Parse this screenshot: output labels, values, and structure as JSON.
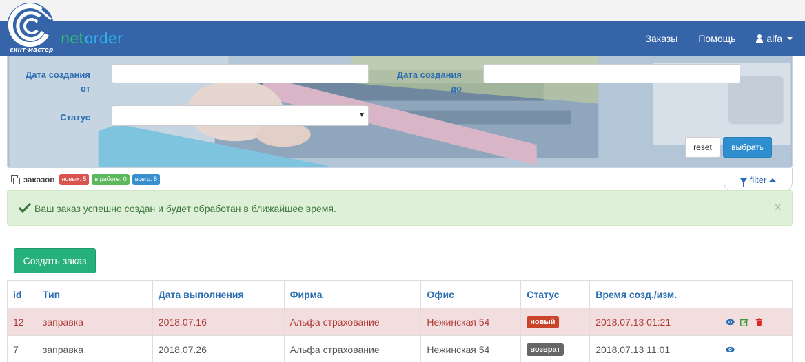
{
  "brand": {
    "logo_text": "синт-мастер",
    "name_part1": "net",
    "name_part2": "order"
  },
  "nav": {
    "orders": "Заказы",
    "help": "Помощь",
    "user": "alfa"
  },
  "filter": {
    "date_from_label_line1": "Дата создания",
    "date_from_label_line2": "от",
    "date_to_label_line1": "Дата создания",
    "date_to_label_line2": "до",
    "status_label": "Статус",
    "date_from_value": "",
    "date_to_value": "",
    "status_value": "",
    "reset_label": "reset",
    "select_label": "выбрать",
    "toggle_label": "filter"
  },
  "stats": {
    "label": "заказов",
    "new_badge": "новых: 5",
    "in_work_badge": "в работе: 0",
    "total_badge": "всего: 8"
  },
  "alert": {
    "message": "Ваш заказ успешно создан и будет обработан в ближайшее время.",
    "close": "×"
  },
  "create_button": "Создать заказ",
  "table": {
    "headers": [
      "id",
      "Тип",
      "Дата выполнения",
      "Фирма",
      "Офис",
      "Статус",
      "Время созд./изм.",
      ""
    ],
    "rows": [
      {
        "id": "12",
        "type": "заправка",
        "due": "2018.07.16",
        "firm": "Альфа страхование",
        "office": "Нежинская 54",
        "status": "новый",
        "time": "2018.07.13 01:21"
      },
      {
        "id": "7",
        "type": "заправка",
        "due": "2018.07.26",
        "firm": "Альфа страхование",
        "office": "Нежинская 54",
        "status": "возврат",
        "time": "2018.07.13 11:01"
      }
    ]
  },
  "colors": {
    "navbar": "#3565a8",
    "badge_new": "#d9534f",
    "badge_in_work": "#5cb85c",
    "badge_total": "#3a8fd0",
    "status_new": "#c9442a",
    "status_return": "#666666",
    "create_button": "#26b07a"
  }
}
